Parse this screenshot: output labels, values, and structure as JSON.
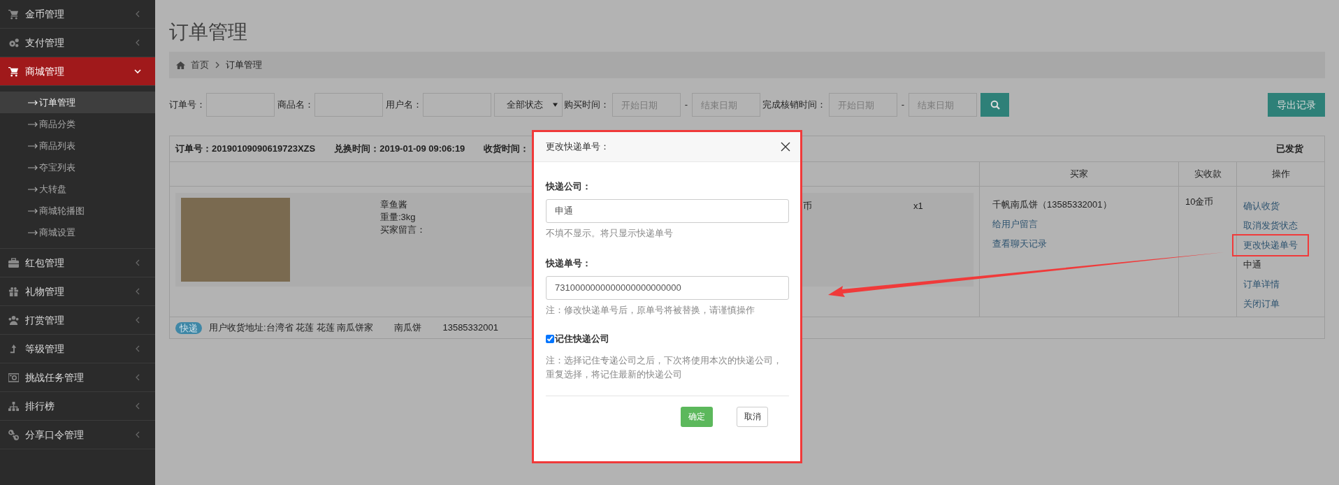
{
  "sidebar": {
    "items": [
      {
        "label": "金币管理",
        "expanded": false
      },
      {
        "label": "支付管理",
        "expanded": false
      },
      {
        "label": "商城管理",
        "expanded": true,
        "children": [
          {
            "label": "订单管理",
            "selected": true
          },
          {
            "label": "商品分类",
            "selected": false
          },
          {
            "label": "商品列表",
            "selected": false
          },
          {
            "label": "夺宝列表",
            "selected": false
          },
          {
            "label": "大转盘",
            "selected": false
          },
          {
            "label": "商城轮播图",
            "selected": false
          },
          {
            "label": "商城设置",
            "selected": false
          }
        ]
      },
      {
        "label": "红包管理",
        "expanded": false
      },
      {
        "label": "礼物管理",
        "expanded": false
      },
      {
        "label": "打赏管理",
        "expanded": false
      },
      {
        "label": "等级管理",
        "expanded": false
      },
      {
        "label": "挑战任务管理",
        "expanded": false
      },
      {
        "label": "排行榜",
        "expanded": false
      },
      {
        "label": "分享口令管理",
        "expanded": false
      }
    ]
  },
  "page_title": "订单管理",
  "breadcrumb": [
    {
      "label": "首页"
    },
    {
      "label": "订单管理"
    }
  ],
  "filters": [
    {
      "kind": "text",
      "label": "订单号："
    },
    {
      "kind": "text",
      "label": "商品名："
    },
    {
      "kind": "text",
      "label": "用户名："
    },
    {
      "kind": "select",
      "value": "全部状态"
    },
    {
      "kind": "daterange",
      "label": "购买时间：",
      "start_placeholder": "开始日期",
      "separator": "-",
      "end_placeholder": "结束日期"
    },
    {
      "kind": "daterange",
      "label": "完成核销时间：",
      "start_placeholder": "开始日期",
      "separator": "-",
      "end_placeholder": "结束日期"
    }
  ],
  "export_button": "导出记录",
  "order": {
    "order_no": "订单号：20190109090619723XZS",
    "exchange_time": "兑换时间：2019-01-09 09:06:19",
    "receive_time": "收货时间：",
    "status": "已发货",
    "columns": [
      "买家",
      "实收款",
      "操作"
    ],
    "product": {
      "lines": [
        "章鱼酱",
        "重量:3kg",
        "买家留言："
      ],
      "price": "币",
      "quantity": "x1"
    },
    "buyer": {
      "name": "千帆南瓜饼（13585332001）",
      "links": [
        "给用户留言",
        "查看聊天记录"
      ]
    },
    "amount": "10金币",
    "actions": [
      {
        "label": "确认收货",
        "kind": "link",
        "highlighted": false
      },
      {
        "label": "取消发货状态",
        "kind": "link",
        "highlighted": false
      },
      {
        "label": "更改快递单号",
        "kind": "link",
        "highlighted": true
      },
      {
        "label": "中通",
        "kind": "text",
        "highlighted": false
      },
      {
        "label": "订单详情",
        "kind": "link",
        "highlighted": false
      },
      {
        "label": "关闭订单",
        "kind": "link",
        "highlighted": false
      }
    ],
    "footer": {
      "tag": "快递",
      "address": "用户收货地址:台湾省 花莲 花莲 南瓜饼家",
      "name": "南瓜饼",
      "phone": "13585332001"
    }
  },
  "dialog": {
    "title": "更改快递单号：",
    "fields": [
      {
        "label": "快递公司：",
        "value": "申通",
        "hint": "不填不显示。将只显示快递单号"
      },
      {
        "label": "快递单号：",
        "value": "7310000000000000000000000",
        "hint": "注：修改快递单号后，原单号将被替换，请谨慎操作"
      }
    ],
    "remember": {
      "label": "记住快递公司",
      "checked": true
    },
    "note": "注：选择记住专递公司之后，下次将使用本次的快递公司，重复选择，将记住最新的快递公司",
    "confirm": "确定",
    "cancel": "取消"
  }
}
